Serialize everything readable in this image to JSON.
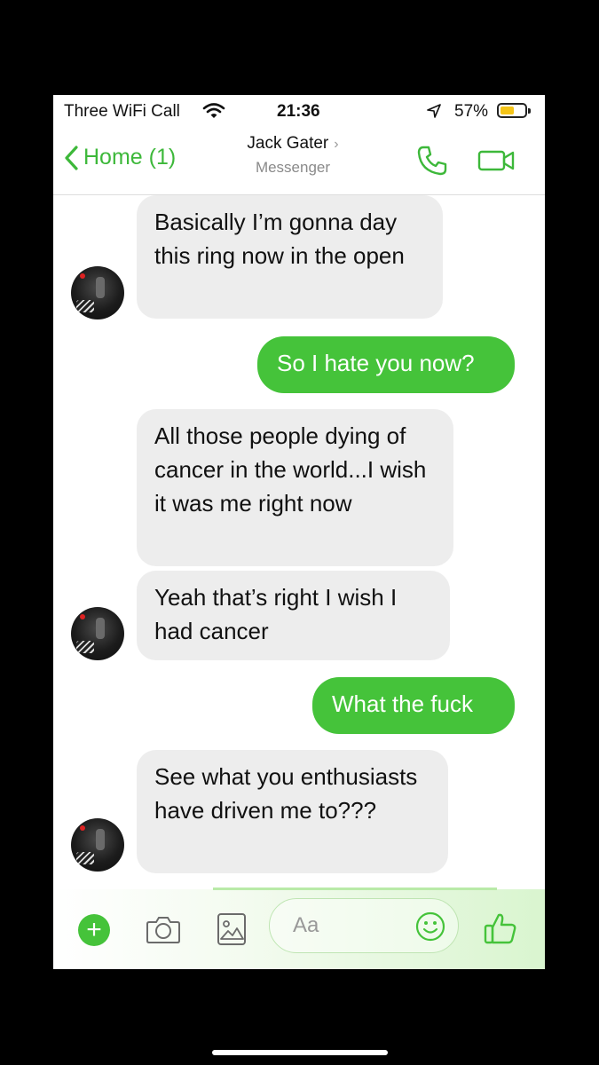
{
  "status_bar": {
    "carrier": "Three WiFi Call",
    "time": "21:36",
    "battery_percent": "57%",
    "battery_level": 0.57,
    "icons": [
      "wifi-icon",
      "location-arrow-icon",
      "battery-icon"
    ]
  },
  "nav": {
    "back_label": "Home (1)",
    "contact_name": "Jack Gater",
    "contact_subtitle": "Messenger",
    "icons": [
      "chevron-left-icon",
      "phone-icon",
      "video-icon"
    ]
  },
  "messages": [
    {
      "from": "them",
      "text": "Basically I’m gonna day this ring now in the open"
    },
    {
      "from": "me",
      "text": "So I hate you now?"
    },
    {
      "from": "them",
      "text": "All those people dying of cancer in the world...I wish it was me right now"
    },
    {
      "from": "them",
      "text": "Yeah that’s right I wish I had cancer"
    },
    {
      "from": "me",
      "text": "What the fuck"
    },
    {
      "from": "them",
      "text": "See what you enthusiasts have driven me to???"
    }
  ],
  "composer": {
    "placeholder": "Aa",
    "icons": [
      "plus-icon",
      "camera-icon",
      "image-icon",
      "emoji-icon",
      "thumbs-up-icon"
    ]
  },
  "colors": {
    "accent": "#45c33a",
    "incoming_bubble": "#ededed",
    "background": "#ffffff",
    "letterbox": "#000000"
  }
}
